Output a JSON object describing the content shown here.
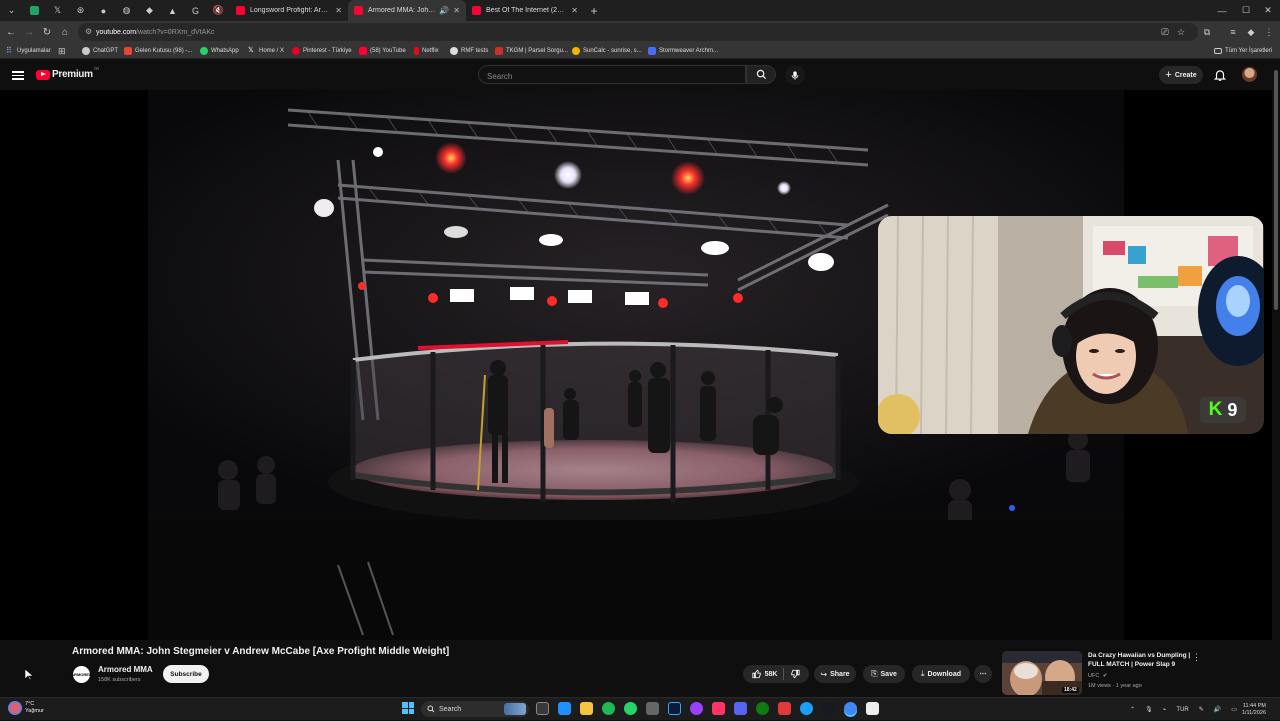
{
  "browser": {
    "pinned_tabs": [
      "sheets-icon",
      "x-icon",
      "openai-icon",
      "github-icon",
      "messenger-icon",
      "notion-icon",
      "google-icon",
      "figma-icon",
      "muted-icon"
    ],
    "tabs": [
      {
        "title": "Longsword Profight: Armored F",
        "active": false
      },
      {
        "title": "Armored MMA: John Stegm",
        "active": true,
        "audio": true
      },
      {
        "title": "Best Of The Internet (2025) - Y",
        "active": false
      }
    ],
    "new_tab": "+",
    "window_controls": {
      "minimize": "—",
      "maximize": "☐",
      "close": "✕"
    },
    "url_domain": "youtube.com",
    "url_path": "/watch?v=0RXm_dVtAKc",
    "bookmarks": [
      {
        "label": "Uygulamalar",
        "color": "#8ab4f8"
      },
      {
        "label": "ChatGPT",
        "color": "#cccccc"
      },
      {
        "label": "Gelen Kutusu (98) -...",
        "color": "#ea4335"
      },
      {
        "label": "WhatsApp",
        "color": "#25d366"
      },
      {
        "label": "Home / X",
        "color": "#ffffff"
      },
      {
        "label": "Pinterest - Türkiye",
        "color": "#e60023"
      },
      {
        "label": "(58) YouTube",
        "color": "#ff0033"
      },
      {
        "label": "Netflix",
        "color": "#e50914"
      },
      {
        "label": "RMF tests",
        "color": "#dddddd"
      },
      {
        "label": "TKGM | Parsel Sorgu...",
        "color": "#c9302c"
      },
      {
        "label": "SunCalc - sunrise, s...",
        "color": "#f5b400"
      },
      {
        "label": "Stormweaver Archm...",
        "color": "#4a6cf7"
      }
    ],
    "all_bookmarks": "Tüm Yer İşaretleri"
  },
  "youtube": {
    "logo_text": "Premium",
    "country_code": "TR",
    "search_placeholder": "Search",
    "create_label": "Create"
  },
  "video": {
    "title": "Armored MMA: John Stegmeier v Andrew McCabe [Axe Profight Middle Weight]",
    "channel_name": "Armored MMA",
    "channel_avatar_text": "ARMORED",
    "subscribers": "158K subscribers",
    "subscribe_label": "Subscribe",
    "likes": "58K",
    "share_label": "Share",
    "save_label": "Save",
    "download_label": "Download",
    "overlay_badge_number": "9",
    "overlay_badge_logo": "K"
  },
  "recommendation": {
    "title": "Da Crazy Hawaiian vs Dumpling | FULL MATCH | Power Slap 9",
    "channel": "UFC",
    "meta": "1M views · 1 year ago",
    "duration": "18:42"
  },
  "taskbar": {
    "weather_temp": "7°C",
    "weather_desc": "Yağmur",
    "search_label": "Search",
    "language": "TUR",
    "time": "11:44 PM",
    "date": "1/11/2026"
  },
  "colors": {
    "youtube_red": "#ff0033",
    "kick_green": "#53fc18",
    "page_bg": "#0f0f0f"
  }
}
